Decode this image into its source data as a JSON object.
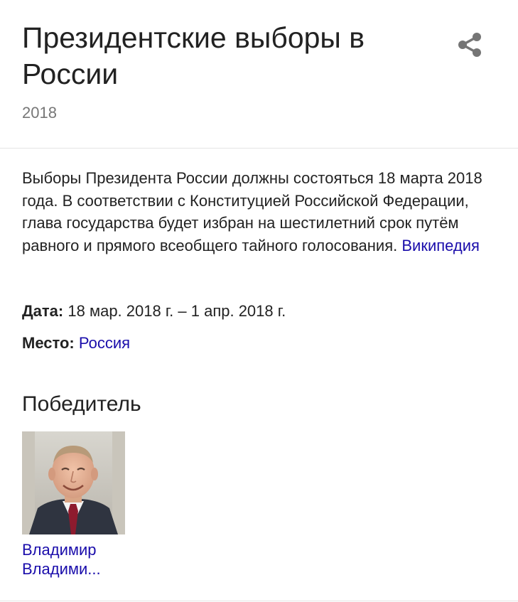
{
  "header": {
    "title": "Президентские выборы в России",
    "subtitle": "2018",
    "share_icon": "share-icon"
  },
  "description": {
    "text": "Выборы Президента России должны состояться 18 марта 2018 года. В соответствии с Конституцией Российской Федерации, глава государства будет избран на шестилетний срок путём равного и прямого всеобщего тайного голосования.",
    "source_link": "Википедия"
  },
  "facts": {
    "date_label": "Дата:",
    "date_value": "18 мар. 2018 г. – 1 апр. 2018 г.",
    "place_label": "Место:",
    "place_value": "Россия"
  },
  "winner": {
    "heading": "Победитель",
    "name_line1": "Владимир",
    "name_line2": "Владими..."
  },
  "colors": {
    "link": "#1a0dab",
    "text": "#222222",
    "muted": "#777777",
    "divider": "#e5e5e5"
  }
}
